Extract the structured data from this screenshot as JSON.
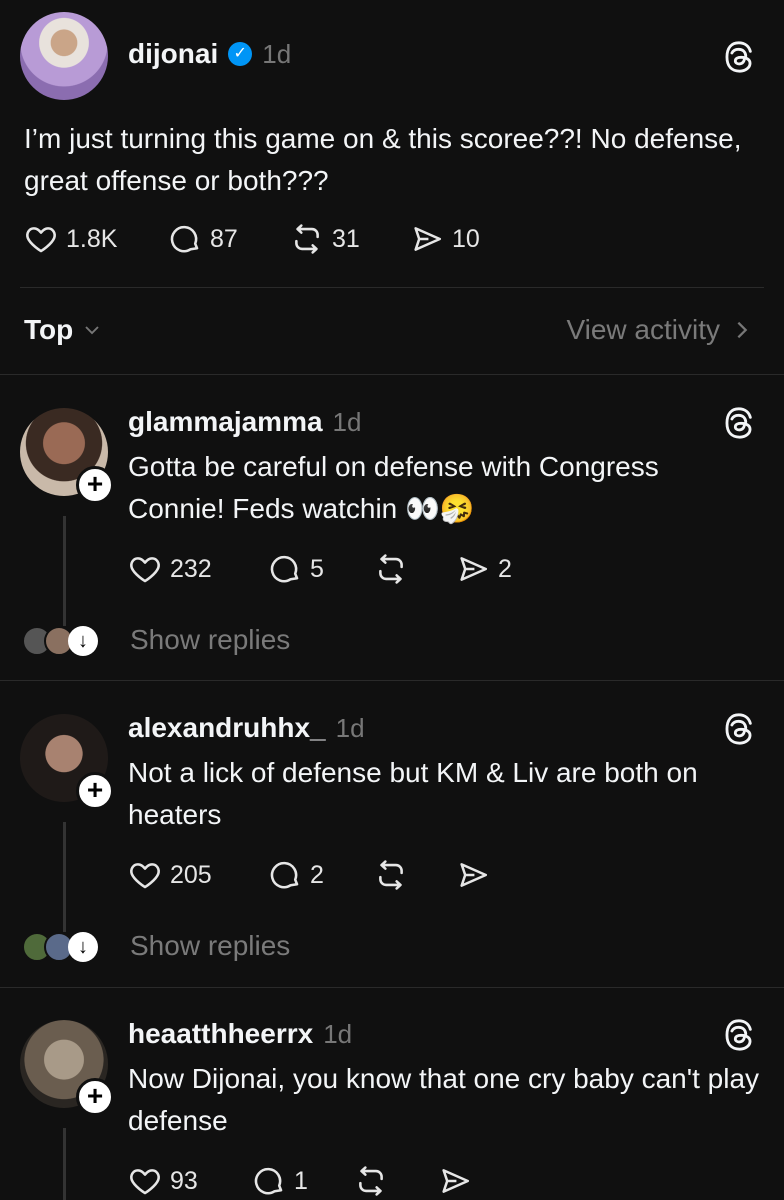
{
  "post": {
    "username": "dijonai",
    "time": "1d",
    "text": "I’m just turning this game on & this scoree??! No defense, great offense or both???",
    "likes": "1.8K",
    "replies": "87",
    "reposts": "31",
    "shares": "10"
  },
  "sort": {
    "label": "Top",
    "view_activity": "View activity"
  },
  "comments": [
    {
      "username": "glammajamma",
      "time": "1d",
      "text": "Gotta be careful on defense with Congress Connie! Feds watchin 👀🤧",
      "likes": "232",
      "replies": "5",
      "reposts": "",
      "shares": "2",
      "show_replies": "Show replies"
    },
    {
      "username": "alexandruhhx_",
      "time": "1d",
      "text": "Not a lick of defense but KM & Liv are both on heaters",
      "likes": "205",
      "replies": "2",
      "reposts": "",
      "shares": "",
      "show_replies": "Show replies"
    },
    {
      "username": "heaatthheerrx",
      "time": "1d",
      "text": "Now Dijonai, you know that one cry baby can't play defense",
      "likes": "93",
      "replies": "1",
      "reposts": "",
      "shares": ""
    }
  ],
  "colors": {
    "background": "#101010",
    "text": "#f3f5f7",
    "muted": "#777777",
    "verified": "#0095f6"
  },
  "icons": [
    "heart-icon",
    "comment-icon",
    "repost-icon",
    "share-icon",
    "threads-logo-icon",
    "verified-badge-icon",
    "plus-icon",
    "chevron-down-icon",
    "chevron-right-icon",
    "arrow-down-icon"
  ]
}
